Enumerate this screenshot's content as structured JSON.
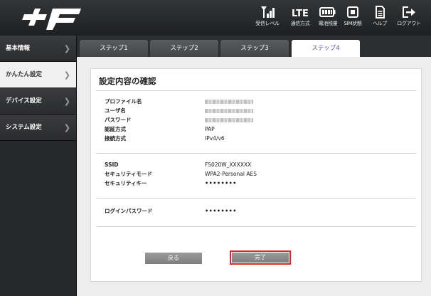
{
  "header": {
    "logo_text": "+F",
    "icons": [
      {
        "name": "signal-icon",
        "label": "受信レベル"
      },
      {
        "name": "lte-icon",
        "label": "通信方式",
        "badge": "LTE"
      },
      {
        "name": "battery-icon",
        "label": "電池残量"
      },
      {
        "name": "sim-icon",
        "label": "SIM状態"
      },
      {
        "name": "help-icon",
        "label": "ヘルプ"
      },
      {
        "name": "logout-icon",
        "label": "ログアウト"
      }
    ]
  },
  "sidebar": {
    "items": [
      {
        "label": "基本情報",
        "active": false
      },
      {
        "label": "かんたん設定",
        "active": true
      },
      {
        "label": "デバイス設定",
        "active": false
      },
      {
        "label": "システム設定",
        "active": false
      }
    ]
  },
  "tabs": [
    "ステップ1",
    "ステップ2",
    "ステップ3",
    "ステップ4"
  ],
  "active_tab": "ステップ4",
  "panel": {
    "title": "設定内容の確認",
    "profile": {
      "profile_name_label": "プロファイル名",
      "username_label": "ユーザ名",
      "password_label": "パスワード",
      "auth_label": "認証方式",
      "auth_value": "PAP",
      "conn_label": "接続方式",
      "conn_value": "IPv4/v6"
    },
    "wifi": {
      "ssid_label": "SSID",
      "ssid_value": "FS020W_XXXXXX",
      "mode_label": "セキュリティモード",
      "mode_value": "WPA2-Personal AES",
      "key_label": "セキュリティキー",
      "key_value": "••••••••"
    },
    "login": {
      "label": "ログインパスワード",
      "value": "••••••••"
    },
    "buttons": {
      "back": "戻る",
      "done": "完了"
    }
  },
  "colors": {
    "active_tab_text": "#555aa8",
    "highlight_border": "#e0262c"
  }
}
